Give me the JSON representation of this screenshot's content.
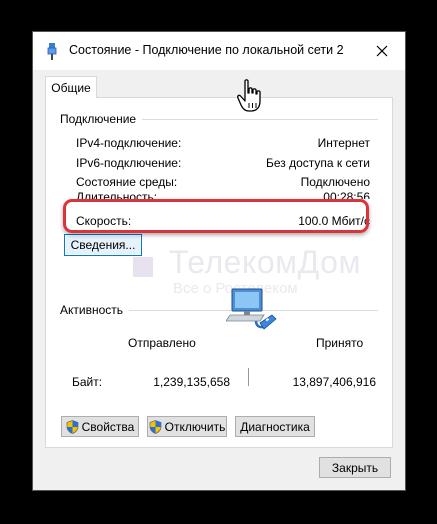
{
  "window": {
    "title": "Состояние - Подключение по локальной сети 2",
    "close_glyph": "✕"
  },
  "tab": {
    "label": "Общие"
  },
  "connection": {
    "group_label": "Подключение",
    "rows": [
      {
        "label": "IPv4-подключение:",
        "value": "Интернет"
      },
      {
        "label": "IPv6-подключение:",
        "value": "Без доступа к сети"
      },
      {
        "label": "Состояние среды:",
        "value": "Подключено"
      },
      {
        "label": "Длительность:",
        "value": "00:28:56"
      },
      {
        "label": "Скорость:",
        "value": "100.0 Мбит/с"
      }
    ],
    "details_button": "Сведения..."
  },
  "activity": {
    "group_label": "Активность",
    "sent_label": "Отправлено",
    "received_label": "Принято",
    "bytes_label": "Байт:",
    "bytes_sent": "1,239,135,658",
    "bytes_received": "13,897,406,916"
  },
  "buttons": {
    "properties": "Свойства",
    "disable": "Отключить",
    "diagnose": "Диагностика",
    "close": "Закрыть"
  },
  "watermark": {
    "title": "ТелекомДом",
    "subtitle": "Все о Ростелеком"
  },
  "colors": {
    "highlight": "#d9343a",
    "focus_border": "#0078d7",
    "dialog_bg": "#f0f0f0"
  },
  "icons": {
    "title": "network-connection-icon",
    "shield": "uac-shield-icon",
    "activity": "network-computer-icon",
    "cursor": "hand-pointer-icon"
  }
}
